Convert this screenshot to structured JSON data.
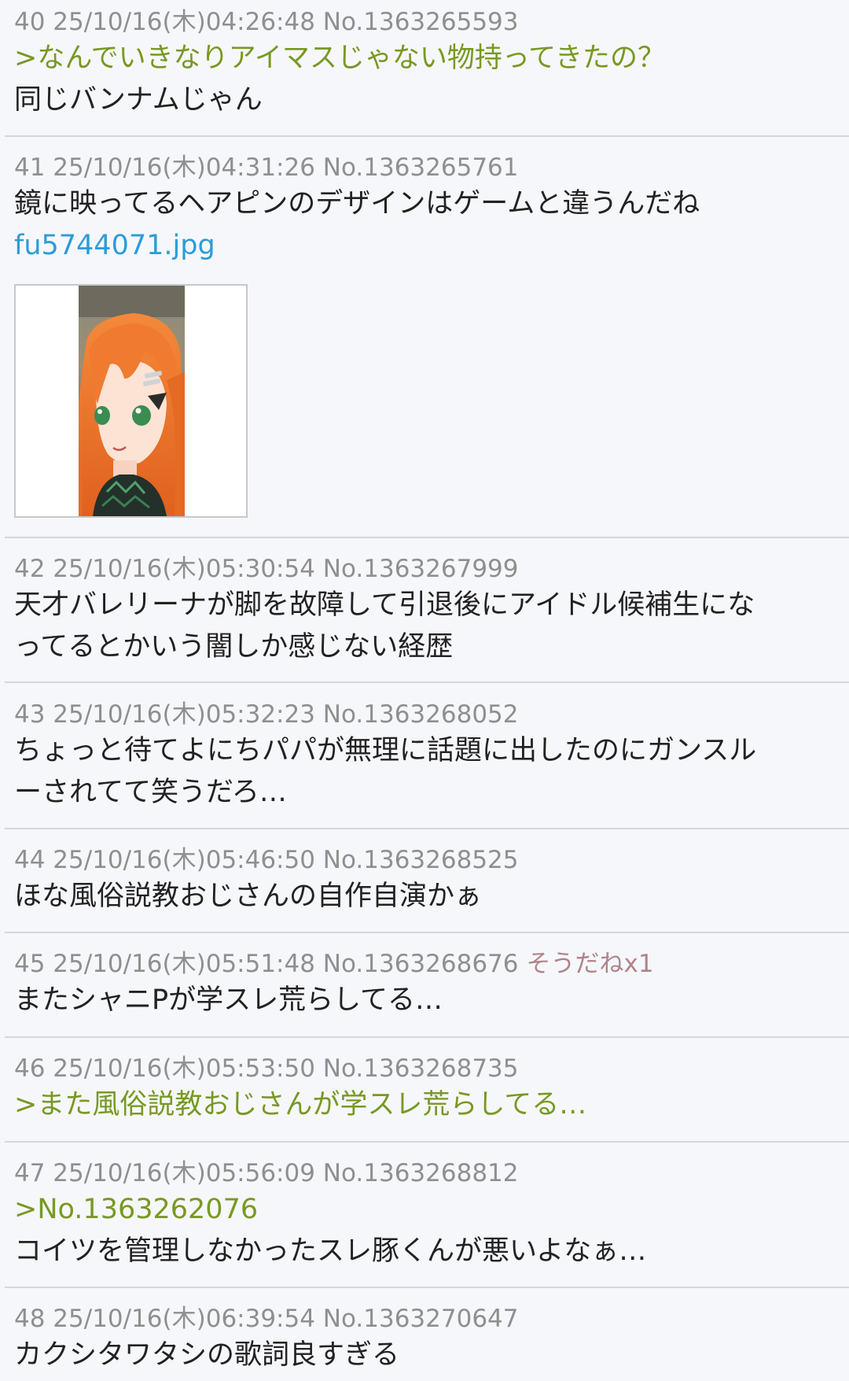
{
  "posts": [
    {
      "header": "40 25/10/16(木)04:26:48 No.1363265593",
      "lines": [
        {
          "text": ">なんでいきなりアイマスじゃない物持ってきたの？",
          "quote": true
        },
        {
          "text": "同じバンナムじゃん",
          "quote": false
        }
      ]
    },
    {
      "header": "41 25/10/16(木)04:31:26 No.1363265761",
      "lines": [
        {
          "text": "鏡に映ってるヘアピンのデザインはゲームと違うんだね",
          "quote": false
        }
      ],
      "file": "fu5744071.jpg"
    },
    {
      "header": "42 25/10/16(木)05:30:54 No.1363267999",
      "lines": [
        {
          "text": "天才バレリーナが脚を故障して引退後にアイドル候補生にな",
          "quote": false
        },
        {
          "text": "ってるとかいう闇しか感じない経歴",
          "quote": false
        }
      ]
    },
    {
      "header": "43 25/10/16(木)05:32:23 No.1363268052",
      "lines": [
        {
          "text": "ちょっと待てよにちパパが無理に話題に出したのにガンスル",
          "quote": false
        },
        {
          "text": "ーされてて笑うだろ…",
          "quote": false
        }
      ]
    },
    {
      "header": "44 25/10/16(木)05:46:50 No.1363268525",
      "lines": [
        {
          "text": "ほな風俗説教おじさんの自作自演かぁ",
          "quote": false
        }
      ]
    },
    {
      "header": "45 25/10/16(木)05:51:48 No.1363268676",
      "sodane": "そうだねx1",
      "lines": [
        {
          "text": "またシャニPが学スレ荒らしてる…",
          "quote": false
        }
      ]
    },
    {
      "header": "46 25/10/16(木)05:53:50 No.1363268735",
      "lines": [
        {
          "text": ">また風俗説教おじさんが学スレ荒らしてる…",
          "quote": true
        }
      ]
    },
    {
      "header": "47 25/10/16(木)05:56:09 No.1363268812",
      "lines": [
        {
          "text": ">No.1363262076",
          "quote": true
        },
        {
          "text": "コイツを管理しなかったスレ豚くんが悪いよなぁ…",
          "quote": false
        }
      ]
    },
    {
      "header": "48 25/10/16(木)06:39:54 No.1363270647",
      "lines": [
        {
          "text": "カクシタワタシの歌詞良すぎる",
          "quote": false
        }
      ]
    }
  ],
  "colors": {
    "background": "#f6f7fb",
    "header": "#8f8f8f",
    "body_text": "#222222",
    "quote": "#789922",
    "file_link": "#2d9cd8",
    "sodane": "#b0848a",
    "divider": "#d6d6d6"
  }
}
